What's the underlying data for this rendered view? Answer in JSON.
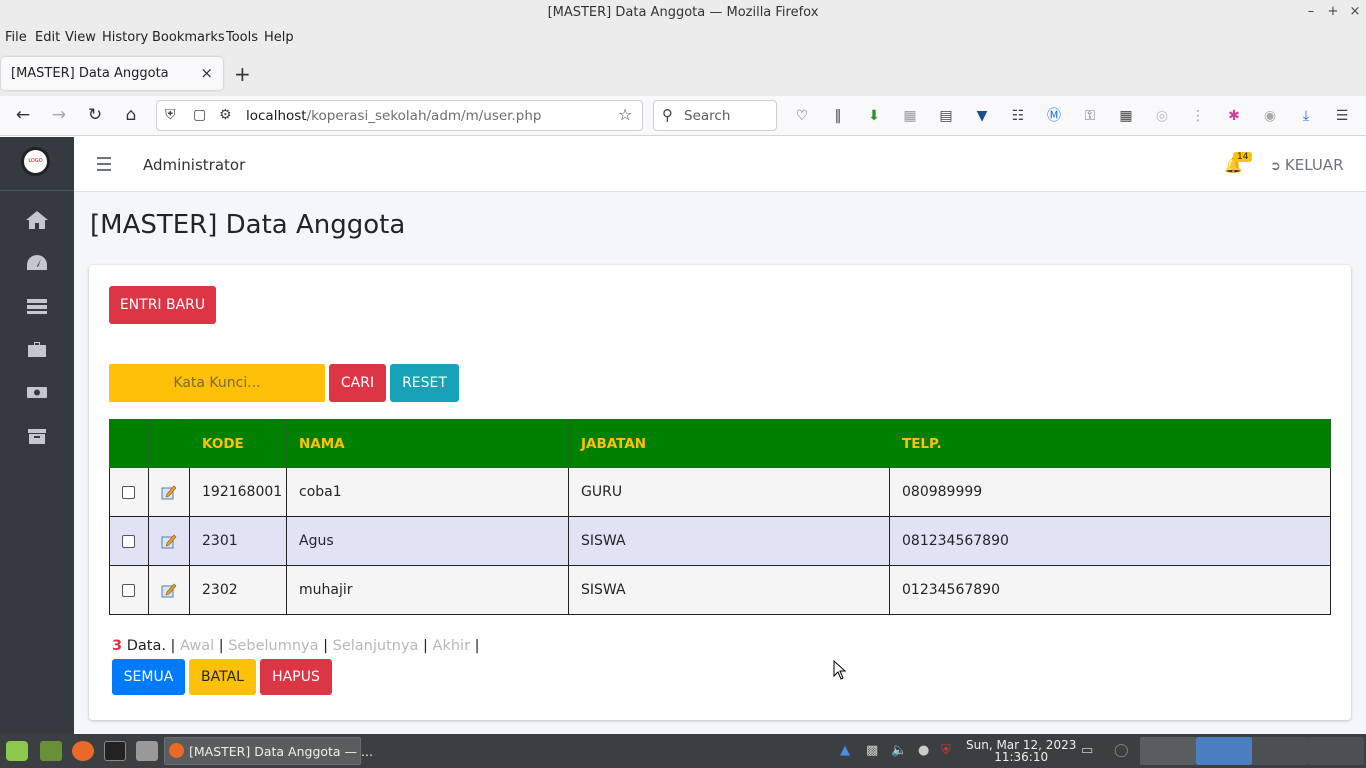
{
  "window": {
    "title": "[MASTER] Data Anggota — Mozilla Firefox",
    "min": "–",
    "max": "+",
    "close": "×"
  },
  "menubar": [
    "File",
    "Edit",
    "View",
    "History",
    "Bookmarks",
    "Tools",
    "Help"
  ],
  "tab": {
    "label": "[MASTER] Data Anggota",
    "close": "×",
    "new_tab": "+"
  },
  "nav": {
    "url_host": "localhost",
    "url_path": "/koperasi_sekolah/adm/m/user.php",
    "search_placeholder": "Search"
  },
  "topnav": {
    "admin_label": "Administrator",
    "notif_count": "14",
    "logout_label": "KELUAR"
  },
  "page": {
    "title": "[MASTER] Data Anggota"
  },
  "logo_text": "LOGO",
  "actions": {
    "new_entry": "ENTRI BARU",
    "search_placeholder": "Kata Kunci...",
    "search": "CARI",
    "reset": "RESET"
  },
  "table": {
    "headers": [
      "",
      "",
      "KODE",
      "NAMA",
      "JABATAN",
      "TELP."
    ],
    "rows": [
      {
        "kode": "192168001",
        "nama": "coba1",
        "jabatan": "GURU",
        "telp": "080989999"
      },
      {
        "kode": "2301",
        "nama": "Agus",
        "jabatan": "SISWA",
        "telp": "081234567890"
      },
      {
        "kode": "2302",
        "nama": "muhajir",
        "jabatan": "SISWA",
        "telp": "01234567890"
      }
    ]
  },
  "pager": {
    "count": "3",
    "count_suffix": "Data.",
    "first": "Awal",
    "prev": "Sebelumnya",
    "next": "Selanjutnya",
    "last": "Akhir",
    "sep": "|"
  },
  "bulk": {
    "all": "SEMUA",
    "cancel": "BATAL",
    "delete": "HAPUS"
  },
  "taskbar": {
    "window_label": "[MASTER] Data Anggota — ...",
    "date": "Sun, Mar 12, 2023",
    "time": "11:36:10"
  },
  "colors": {
    "header_green": "#008000",
    "header_text": "#ffc107",
    "sidebar": "#343a40",
    "danger": "#dc3545",
    "info": "#17a2b8",
    "primary": "#007bff",
    "warning": "#ffc107"
  }
}
